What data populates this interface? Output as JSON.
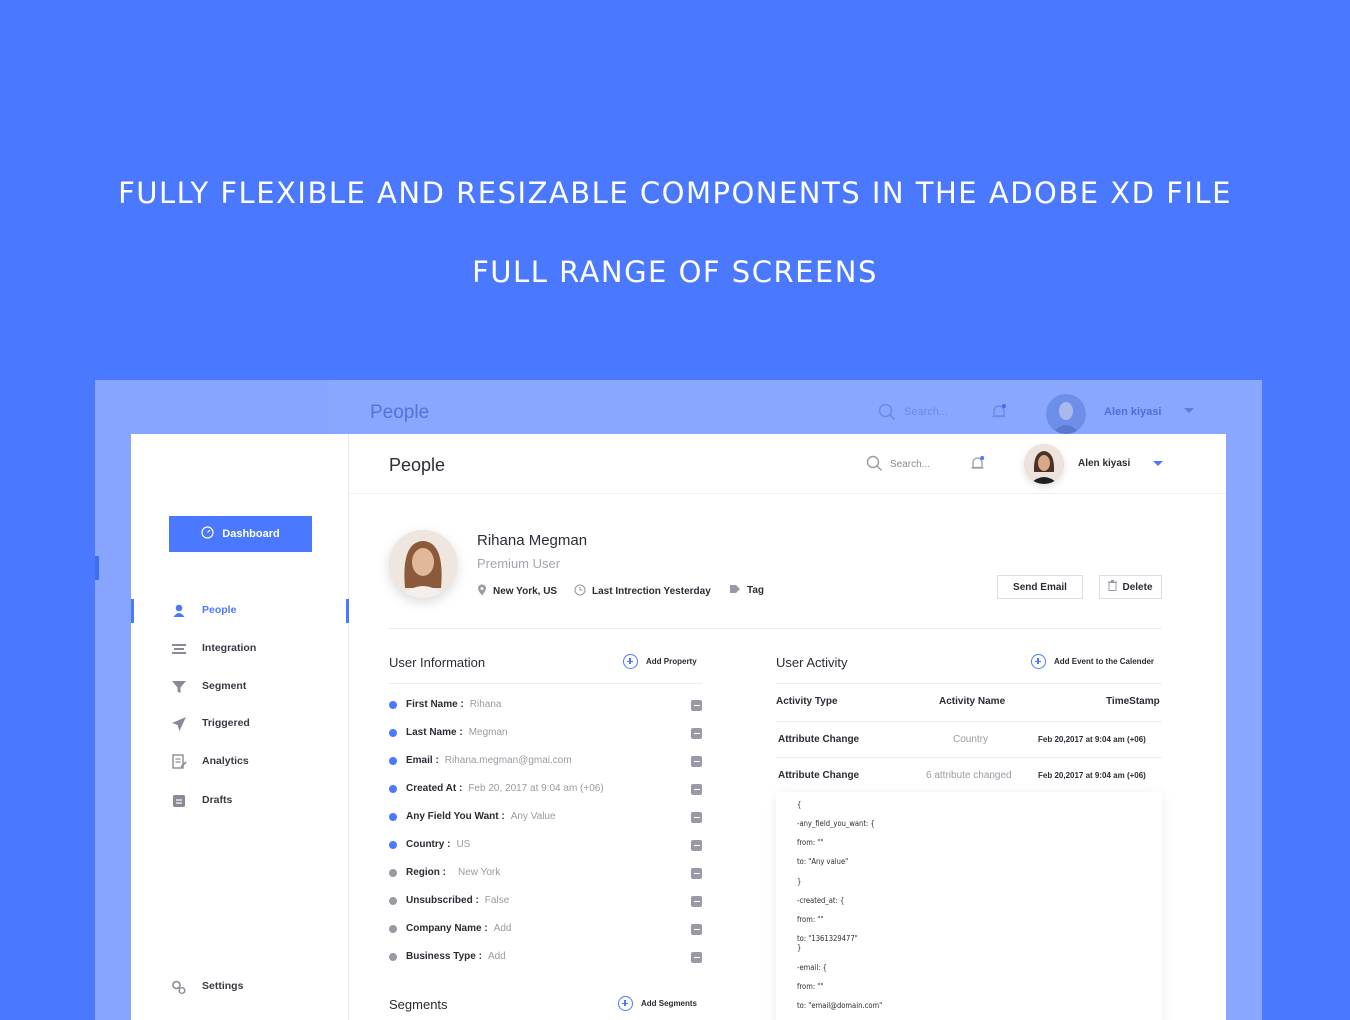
{
  "hero": {
    "line1": "FULLY FLEXIBLE AND RESIZABLE COMPONENTS IN THE ADOBE XD FILE",
    "line2": "FULL RANGE OF SCREENS"
  },
  "ghost": {
    "title": "People",
    "search_placeholder": "Search...",
    "user_name": "Alen kiyasi"
  },
  "header": {
    "title": "People",
    "search_placeholder": "Search...",
    "user_name": "Alen kiyasi"
  },
  "sidebar": {
    "dashboard_label": "Dashboard",
    "items": [
      {
        "label": "People",
        "icon": "person-icon"
      },
      {
        "label": "Integration",
        "icon": "integration-icon"
      },
      {
        "label": "Segment",
        "icon": "filter-icon"
      },
      {
        "label": "Triggered",
        "icon": "send-icon"
      },
      {
        "label": "Analytics",
        "icon": "analytics-icon"
      },
      {
        "label": "Drafts",
        "icon": "drafts-icon"
      }
    ],
    "settings_label": "Settings"
  },
  "profile": {
    "name": "Rihana Megman",
    "role": "Premium User",
    "location": "New York, US",
    "last_interaction": "Last Intrection Yesterday",
    "tag": "Tag",
    "send_email_label": "Send Email",
    "delete_label": "Delete"
  },
  "user_info": {
    "title": "User Information",
    "add_label": "Add Property",
    "rows": [
      {
        "key": "First Name :",
        "value": "Rihana"
      },
      {
        "key": "Last Name :",
        "value": "Megman"
      },
      {
        "key": "Email :",
        "value": "Rihana.megman@gmai.com"
      },
      {
        "key": "Created At :",
        "value": "Feb 20, 2017 at 9:04 am (+06)"
      },
      {
        "key": "Any Field You Want :",
        "value": "Any Value"
      },
      {
        "key": "Country :",
        "value": "US"
      },
      {
        "key": "Region :",
        "value": "New York"
      },
      {
        "key": "Unsubscribed :",
        "value": "False"
      },
      {
        "key": "Company Name :",
        "value": "Add"
      },
      {
        "key": "Business Type :",
        "value": "Add"
      }
    ]
  },
  "segments": {
    "title": "Segments",
    "add_label": "Add Segments"
  },
  "activity": {
    "title": "User Activity",
    "add_label": "Add Event to the Calender",
    "headers": [
      "Activity Type",
      "Activity Name",
      "TimeStamp"
    ],
    "rows": [
      {
        "type": "Attribute Change",
        "name": "Country",
        "time": "Feb 20,2017 at 9:04 am (+06)"
      },
      {
        "type": "Attribute Change",
        "name": "6 attribute changed",
        "time": "Feb 20,2017 at 9:04 am (+06)"
      }
    ],
    "json_lines": [
      "{",
      "-any_field_you_want: {",
      "from: \"\"",
      "to: \"Any value\"",
      "}",
      "-created_at: {",
      "from: \"\"",
      "to: \"1361329477\"",
      "}",
      "-email: {",
      "from: \"\"",
      "to: \"email@domain.com\""
    ]
  },
  "colors": {
    "accent": "#4a79ff",
    "background": "#4a79ff"
  }
}
